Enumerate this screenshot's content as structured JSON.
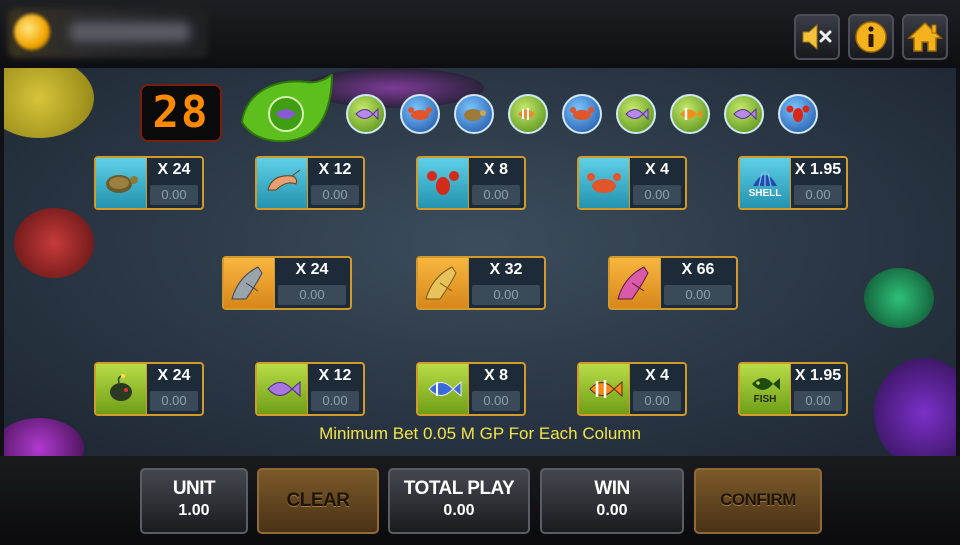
{
  "header": {
    "mute_icon": "speaker-mute-icon",
    "info_icon": "info-icon",
    "home_icon": "home-icon"
  },
  "game": {
    "countdown": "28",
    "history": [
      "purple-fish",
      "crab",
      "turtle",
      "lionfish",
      "crab",
      "purple-fish",
      "clownfish",
      "purple-fish",
      "lobster"
    ],
    "minimum_bet_note": "Minimum Bet 0.05 M GP For Each Column"
  },
  "bets": [
    {
      "id": "turtle",
      "group": "blue",
      "icon": "turtle-icon",
      "multiplier": "X 24",
      "amount": "0.00"
    },
    {
      "id": "shrimp",
      "group": "blue",
      "icon": "shrimp-icon",
      "multiplier": "X 12",
      "amount": "0.00"
    },
    {
      "id": "lobster",
      "group": "blue",
      "icon": "lobster-icon",
      "multiplier": "X 8",
      "amount": "0.00"
    },
    {
      "id": "crab",
      "group": "blue",
      "icon": "crab-icon",
      "multiplier": "X 4",
      "amount": "0.00"
    },
    {
      "id": "shell",
      "group": "blue",
      "icon": "shell-icon",
      "icon_text": "SHELL",
      "multiplier": "X 1.95",
      "amount": "0.00"
    },
    {
      "id": "grey-shark",
      "group": "orange",
      "icon": "grey-shark-icon",
      "multiplier": "X 24",
      "amount": "0.00"
    },
    {
      "id": "gold-shark",
      "group": "orange",
      "icon": "gold-shark-icon",
      "multiplier": "X 32",
      "amount": "0.00"
    },
    {
      "id": "pink-shark",
      "group": "orange",
      "icon": "pink-shark-icon",
      "multiplier": "X 66",
      "amount": "0.00"
    },
    {
      "id": "anglerfish",
      "group": "green",
      "icon": "anglerfish-icon",
      "multiplier": "X 24",
      "amount": "0.00"
    },
    {
      "id": "purple-fish",
      "group": "green",
      "icon": "purple-fish-icon",
      "multiplier": "X 12",
      "amount": "0.00"
    },
    {
      "id": "blue-fish",
      "group": "green",
      "icon": "blue-fish-icon",
      "multiplier": "X 8",
      "amount": "0.00"
    },
    {
      "id": "clownfish",
      "group": "green",
      "icon": "clownfish-icon",
      "multiplier": "X 4",
      "amount": "0.00"
    },
    {
      "id": "fish",
      "group": "green",
      "icon": "fish-icon",
      "icon_text": "FISH",
      "multiplier": "X 1.95",
      "amount": "0.00"
    }
  ],
  "footer": {
    "unit_label": "UNIT",
    "unit_value": "1.00",
    "clear_label": "CLEAR",
    "total_play_label": "TOTAL PLAY",
    "total_play_value": "0.00",
    "win_label": "WIN",
    "win_value": "0.00",
    "confirm_label": "CONFIRM"
  },
  "colors": {
    "accent_orange": "#d19a2a",
    "counter_digits": "#ff8a00",
    "note_text": "#f2e34a"
  }
}
